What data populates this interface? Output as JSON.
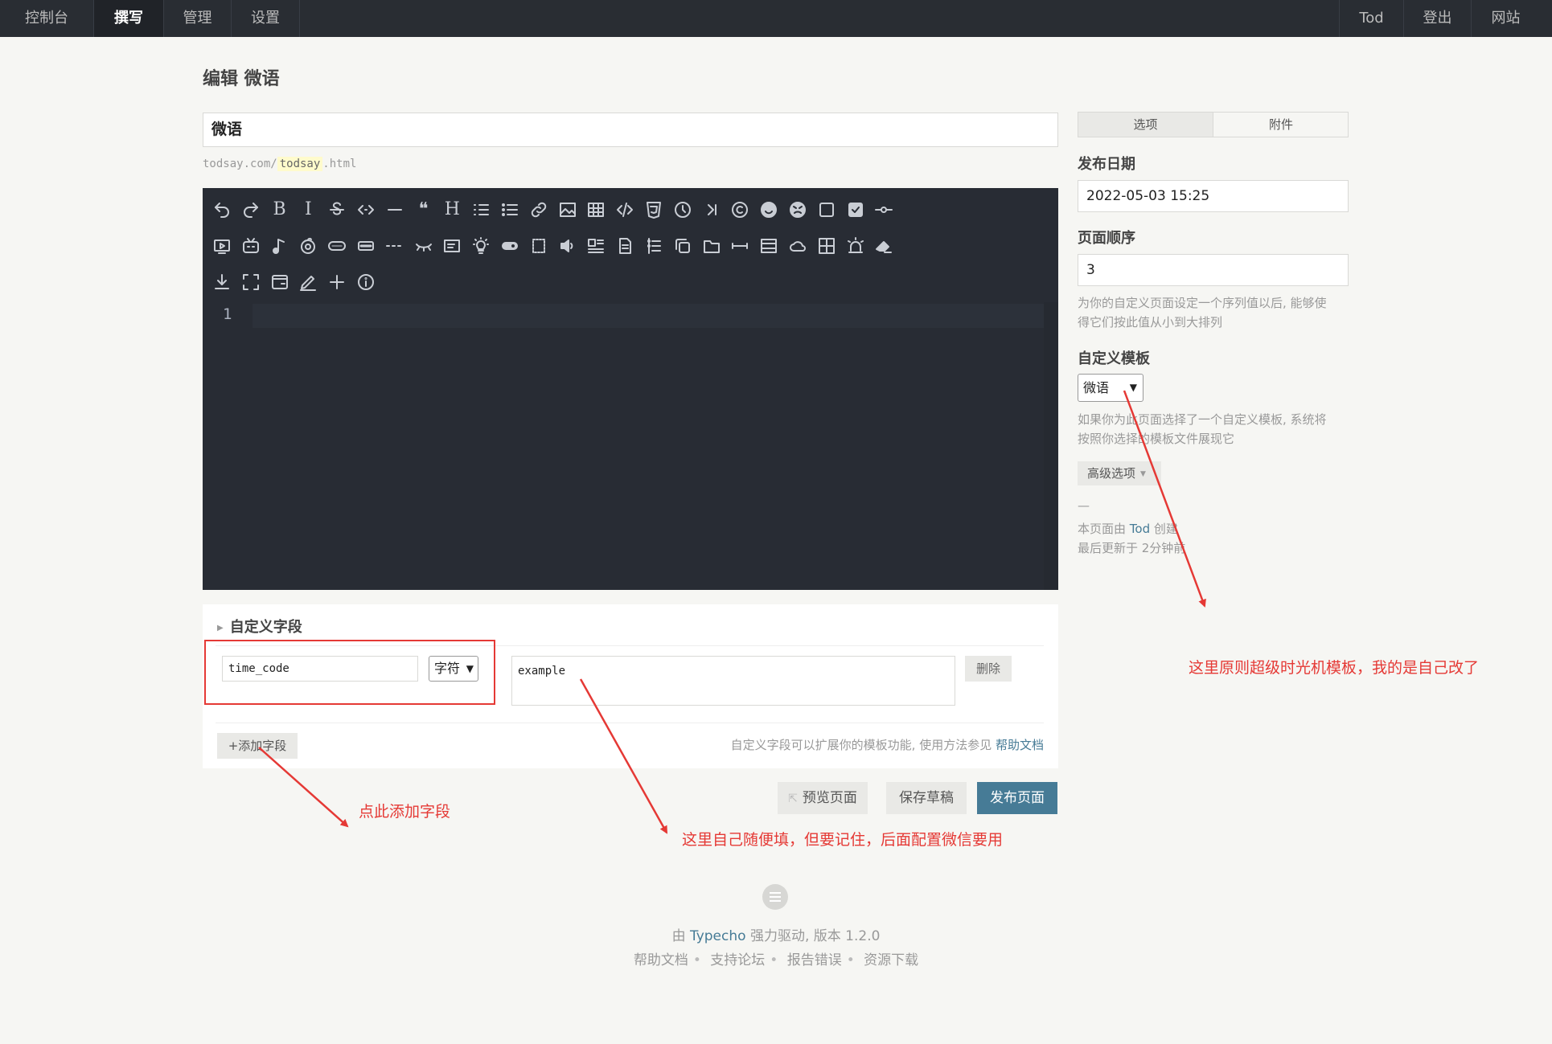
{
  "nav": {
    "left": [
      "控制台",
      "撰写",
      "管理",
      "设置"
    ],
    "active": "撰写",
    "right": [
      "Tod",
      "登出",
      "网站"
    ]
  },
  "page_title": "编辑 微语",
  "title_value": "微语",
  "slug": {
    "prefix": "todsay.com/",
    "value": "todsay",
    "suffix": ".html"
  },
  "editor": {
    "toolbar_row1": [
      "undo-icon",
      "redo-icon",
      "bold-icon",
      "italic-icon",
      "strikethrough-icon",
      "code-inline-icon",
      "horizontal-rule-icon",
      "quote-icon",
      "heading-icon",
      "ordered-list-icon",
      "unordered-list-icon",
      "link-icon",
      "image-icon",
      "table-icon",
      "code-block-icon",
      "html5-icon",
      "clock-icon",
      "arrow-right-bar-icon",
      "copyright-icon",
      "smile-emoji-icon",
      "angry-emoji-icon",
      "checkbox-empty-icon",
      "checkbox-checked-icon",
      "slider-line-icon"
    ],
    "toolbar_row2": [
      "video-icon",
      "bilibili-icon",
      "music-note-icon",
      "netease-music-icon",
      "btn-icon",
      "button-box-icon",
      "dotted-line-icon",
      "hide-eye-icon",
      "card-icon",
      "bulb-icon",
      "toggle-icon",
      "dashed-box-icon",
      "volume-icon",
      "gallery-icon",
      "article-icon",
      "timeline-icon",
      "copy-icon",
      "tabs-icon",
      "arrows-horizontal-icon",
      "panel-icon",
      "cloud-icon",
      "grid-icon",
      "alarm-icon",
      "eraser-icon"
    ],
    "toolbar_row3": [
      "download-icon",
      "fullscreen-icon",
      "window-icon",
      "pencil-icon",
      "plus-icon",
      "info-icon"
    ],
    "line_number": "1"
  },
  "custom_fields": {
    "title": "自定义字段",
    "field_name": "time_code",
    "field_type": "字符",
    "field_value": "example",
    "delete_label": "删除",
    "add_label": "+添加字段",
    "hint": "自定义字段可以扩展你的模板功能, 使用方法参见 ",
    "hint_link": "帮助文档"
  },
  "actions": {
    "preview": "预览页面",
    "save": "保存草稿",
    "publish": "发布页面"
  },
  "sidebar": {
    "tabs": [
      "选项",
      "附件"
    ],
    "date_label": "发布日期",
    "date_value": "2022-05-03 15:25",
    "order_label": "页面顺序",
    "order_value": "3",
    "order_desc_1": "为你的自定义页面设定一个序列值以后, 能够使",
    "order_desc_2": "得它们按此值从小到大排列",
    "template_label": "自定义模板",
    "template_value": "微语",
    "template_desc_1": "如果你为此页面选择了一个自定义模板, 系统将",
    "template_desc_2": "按照你选择的模板文件展现它",
    "advanced_label": "高级选项",
    "dash": "—",
    "created_prefix": "本页面由 ",
    "created_user": "Tod",
    "created_suffix": " 创建",
    "updated": "最后更新于 2分钟前"
  },
  "footer": {
    "powered_prefix": "由 ",
    "powered_link": "Typecho",
    "powered_suffix": " 强力驱动, 版本 1.2.0",
    "links": [
      "帮助文档",
      "支持论坛",
      "报告错误",
      "资源下载"
    ]
  },
  "annotations": {
    "add_field": "点此添加字段",
    "value_note": "这里自己随便填，但要记住，后面配置微信要用",
    "template_note": "这里原则超级时光机模板，我的是自己改了"
  },
  "colors": {
    "accent": "#467b96",
    "annotation": "#e53935",
    "nav_bg": "#292d33",
    "editor_bg": "#282c34"
  }
}
